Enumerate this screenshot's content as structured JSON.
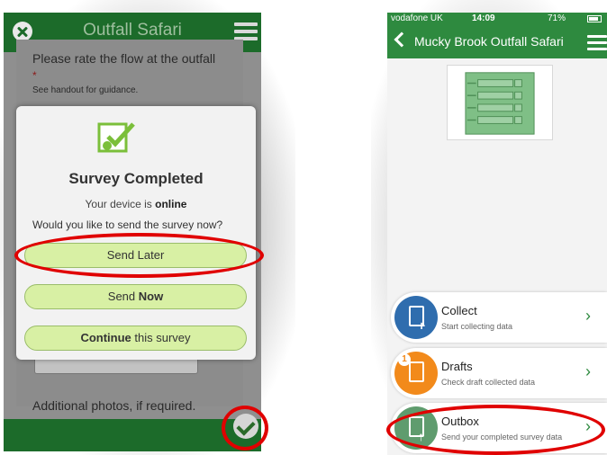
{
  "left_screen": {
    "app_title": "Outfall Safari",
    "question": "Please rate the flow at the outfall",
    "required_marker": "*",
    "hint": "See handout for guidance.",
    "additional": "Additional photos, if required.",
    "dialog": {
      "title": "Survey Completed",
      "online_prefix": "Your device is ",
      "online_status": "online",
      "question": "Would you like to send the survey now?",
      "send_later": "Send Later",
      "send_now_prefix": "Send ",
      "send_now_bold": "Now",
      "continue_bold": "Continue",
      "continue_suffix": " this survey"
    }
  },
  "right_screen": {
    "status_bar": {
      "carrier": "vodafone UK",
      "time": "14:09",
      "battery": "71%"
    },
    "app_title": "Mucky Brook Outfall Safari",
    "menu": [
      {
        "title": "Collect",
        "subtitle": "Start collecting data",
        "icon": "collect-document-plus-icon",
        "color": "#2f6dae"
      },
      {
        "title": "Drafts",
        "subtitle": "Check draft collected data",
        "icon": "drafts-document-icon",
        "badge": "1",
        "color": "#f28a1b"
      },
      {
        "title": "Outbox",
        "subtitle": "Send your completed survey data",
        "icon": "outbox-document-upload-icon",
        "color": "#5f9c6e"
      }
    ]
  },
  "colors": {
    "left_header": "#1c6b2a",
    "right_header": "#2e8a3f",
    "dialog_button": "#d8f0a4",
    "annotation_red": "#e00000"
  }
}
